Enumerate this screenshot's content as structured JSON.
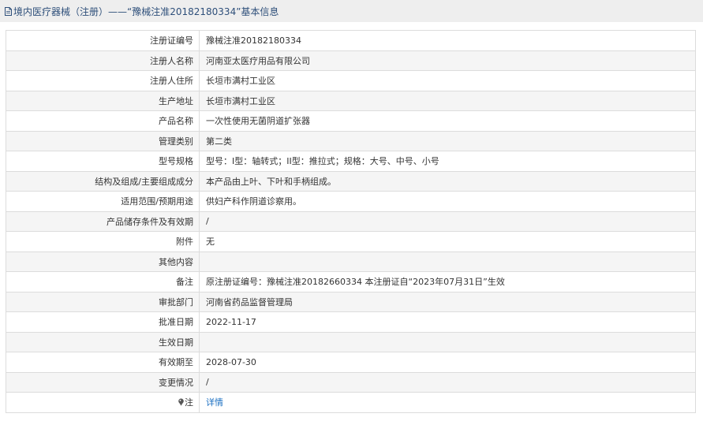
{
  "header": {
    "title": "境内医疗器械（注册）——“豫械注准20182180334”基本信息"
  },
  "rows": [
    {
      "label": "注册证编号",
      "value": "豫械注准20182180334"
    },
    {
      "label": "注册人名称",
      "value": "河南亚太医疗用品有限公司"
    },
    {
      "label": "注册人住所",
      "value": "长垣市满村工业区"
    },
    {
      "label": "生产地址",
      "value": "长垣市满村工业区"
    },
    {
      "label": "产品名称",
      "value": "一次性使用无菌阴道扩张器"
    },
    {
      "label": "管理类别",
      "value": "第二类"
    },
    {
      "label": "型号规格",
      "value": "型号：I型：轴转式；II型：推拉式；规格：大号、中号、小号"
    },
    {
      "label": "结构及组成/主要组成成分",
      "value": "本产品由上叶、下叶和手柄组成。"
    },
    {
      "label": "适用范围/预期用途",
      "value": "供妇产科作阴道诊察用。"
    },
    {
      "label": "产品储存条件及有效期",
      "value": "/"
    },
    {
      "label": "附件",
      "value": "无"
    },
    {
      "label": "其他内容",
      "value": ""
    },
    {
      "label": "备注",
      "value": "原注册证编号：豫械注准20182660334 本注册证自“2023年07月31日”生效"
    },
    {
      "label": "审批部门",
      "value": "河南省药品监督管理局"
    },
    {
      "label": "批准日期",
      "value": "2022-11-17"
    },
    {
      "label": "生效日期",
      "value": ""
    },
    {
      "label": "有效期至",
      "value": "2028-07-30"
    },
    {
      "label": "变更情况",
      "value": "/"
    }
  ],
  "note": {
    "label": "注",
    "link_text": "详情",
    "icon": "pin-icon"
  },
  "colors": {
    "header_bg": "#eeeeee",
    "title_text": "#2e4f7a",
    "link": "#1a6fc2",
    "border": "#dcdcdc",
    "row_alt": "#f5f5f5"
  }
}
